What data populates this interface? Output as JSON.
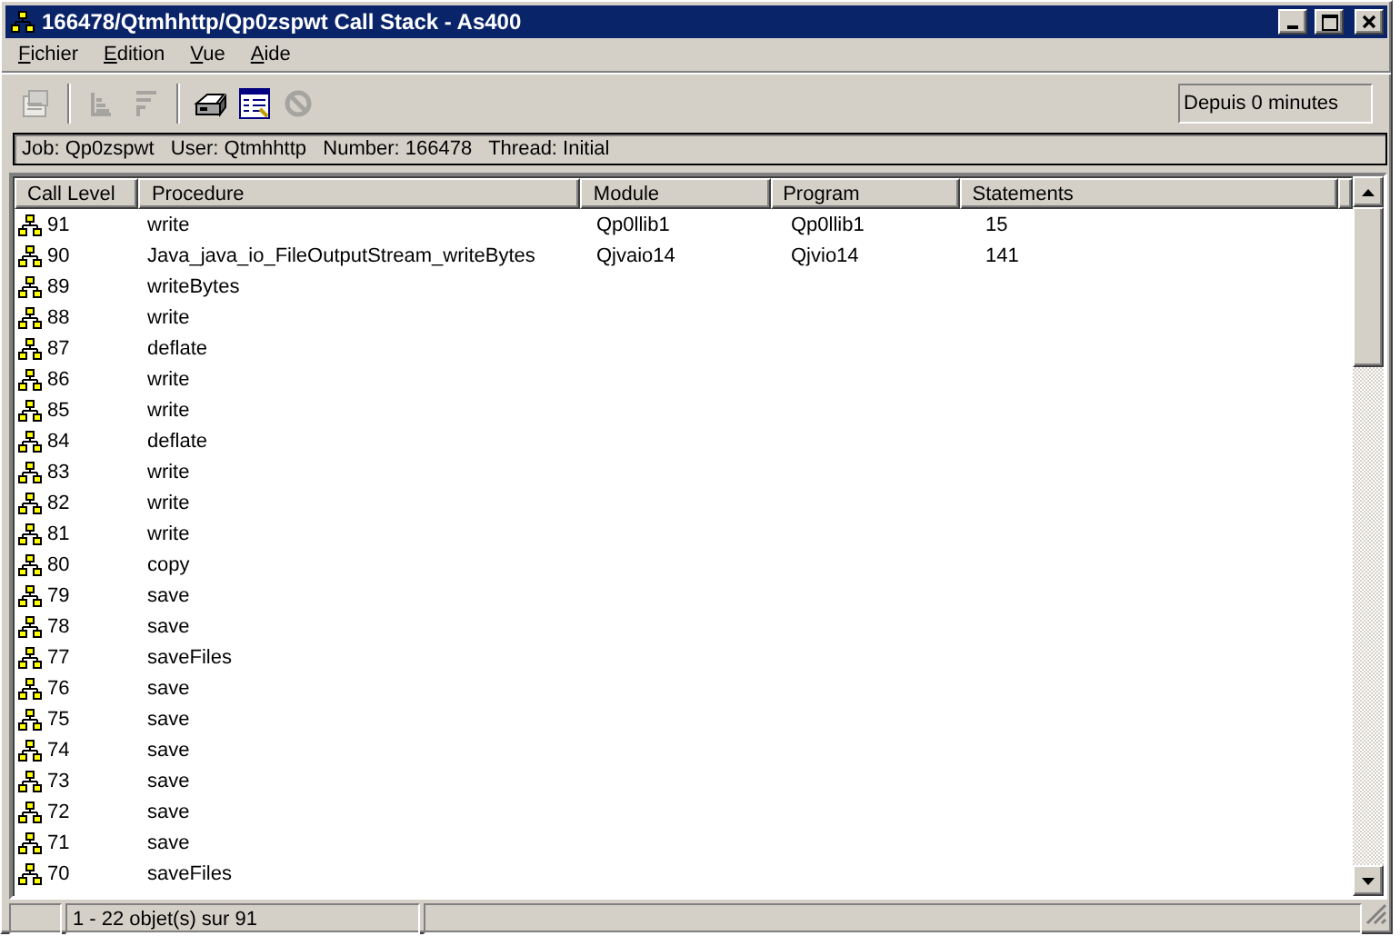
{
  "window": {
    "title": "166478/Qtmhhttp/Qp0zspwt Call Stack - As400"
  },
  "menu": [
    "Fichier",
    "Edition",
    "Vue",
    "Aide"
  ],
  "toolbar": [
    {
      "kind": "properties",
      "disabled": true
    },
    {
      "kind": "sort-up",
      "disabled": true
    },
    {
      "kind": "sort-down",
      "disabled": true
    },
    {
      "kind": "print",
      "disabled": false
    },
    {
      "kind": "table",
      "disabled": false
    },
    {
      "kind": "stop",
      "disabled": true
    }
  ],
  "refresh_status": "Depuis 0 minutes",
  "job_info": "Job: Qp0zspwt   User: Qtmhhttp   Number: 166478   Thread: Initial",
  "table": {
    "columns": [
      "Call Level",
      "Procedure",
      "Module",
      "Program",
      "Statements"
    ],
    "rows": [
      [
        "91",
        "write",
        "Qp0llib1",
        "Qp0llib1",
        "15"
      ],
      [
        "90",
        "Java_java_io_FileOutputStream_writeBytes",
        "Qjvaio14",
        "Qjvio14",
        "141"
      ],
      [
        "89",
        "writeBytes",
        "",
        "",
        ""
      ],
      [
        "88",
        "write",
        "",
        "",
        ""
      ],
      [
        "87",
        "deflate",
        "",
        "",
        ""
      ],
      [
        "86",
        "write",
        "",
        "",
        ""
      ],
      [
        "85",
        "write",
        "",
        "",
        ""
      ],
      [
        "84",
        "deflate",
        "",
        "",
        ""
      ],
      [
        "83",
        "write",
        "",
        "",
        ""
      ],
      [
        "82",
        "write",
        "",
        "",
        ""
      ],
      [
        "81",
        "write",
        "",
        "",
        ""
      ],
      [
        "80",
        "copy",
        "",
        "",
        ""
      ],
      [
        "79",
        "save",
        "",
        "",
        ""
      ],
      [
        "78",
        "save",
        "",
        "",
        ""
      ],
      [
        "77",
        "saveFiles",
        "",
        "",
        ""
      ],
      [
        "76",
        "save",
        "",
        "",
        ""
      ],
      [
        "75",
        "save",
        "",
        "",
        ""
      ],
      [
        "74",
        "save",
        "",
        "",
        ""
      ],
      [
        "73",
        "save",
        "",
        "",
        ""
      ],
      [
        "72",
        "save",
        "",
        "",
        ""
      ],
      [
        "71",
        "save",
        "",
        "",
        ""
      ],
      [
        "70",
        "saveFiles",
        "",
        "",
        ""
      ]
    ]
  },
  "status_bar": {
    "item_count": "1 - 22 objet(s) sur 91"
  }
}
